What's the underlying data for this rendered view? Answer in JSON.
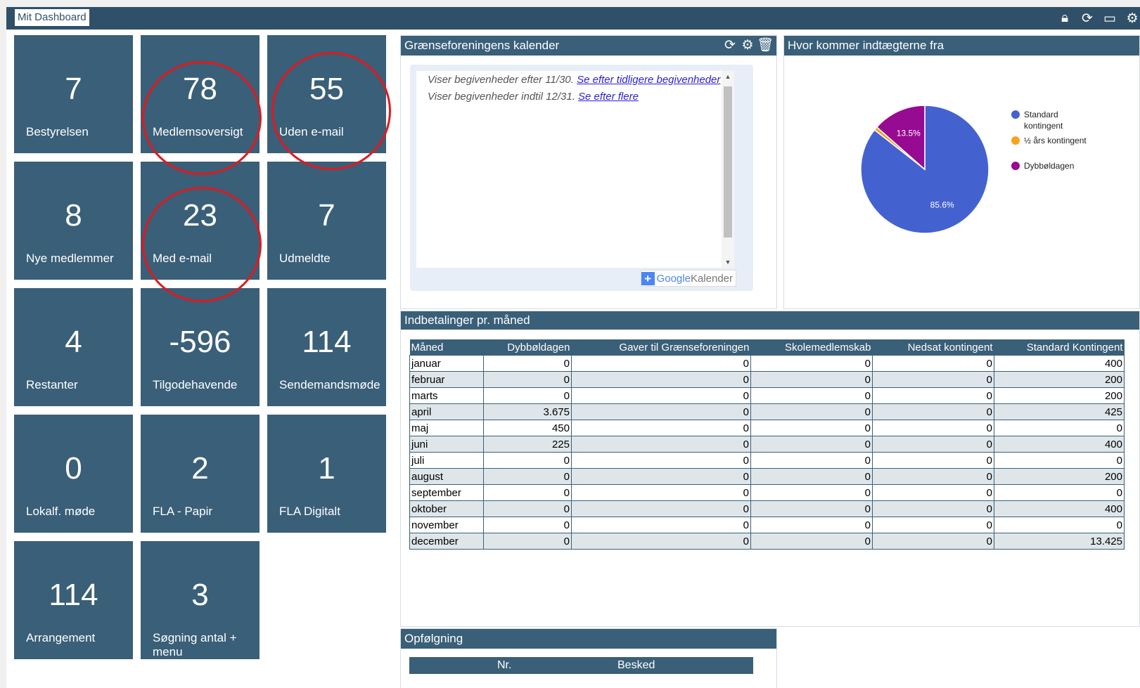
{
  "app_title": "Mit Dashboard",
  "top_icons": [
    "lock-icon",
    "refresh-icon",
    "monitor-settings-icon",
    "gear-icon"
  ],
  "tiles": [
    {
      "value": "7",
      "label": "Bestyrelsen"
    },
    {
      "value": "78",
      "label": "Medlemsoversigt"
    },
    {
      "value": "55",
      "label": "Uden e-mail"
    },
    {
      "value": "8",
      "label": "Nye medlemmer"
    },
    {
      "value": "23",
      "label": "Med e-mail"
    },
    {
      "value": "7",
      "label": "Udmeldte"
    },
    {
      "value": "4",
      "label": "Restanter"
    },
    {
      "value": "-596",
      "label": "Tilgodehavende"
    },
    {
      "value": "114",
      "label": "Sendemandsmøde"
    },
    {
      "value": "0",
      "label": "Lokalf. møde"
    },
    {
      "value": "2",
      "label": "FLA - Papir"
    },
    {
      "value": "1",
      "label": "FLA Digitalt"
    },
    {
      "value": "114",
      "label": "Arrangement"
    },
    {
      "value": "3",
      "label": "Søgning antal + menu"
    }
  ],
  "calendar": {
    "title": "Grænseforeningens kalender",
    "line1_text": "Viser begivenheder efter 11/30.",
    "line1_link": "Se efter tidligere begivenheder",
    "line2_text": "Viser begivenheder indtil 12/31.",
    "line2_link": "Se efter flere",
    "google_brand": "Google",
    "calendar_word": "Kalender"
  },
  "income": {
    "title": "Hvor kommer indtægterne fra",
    "legend": [
      {
        "label": "Standard kontingent",
        "color": "#4462cf"
      },
      {
        "label": "½ års kontingent",
        "color": "#f7a21c"
      },
      {
        "label": "Dybbøldagen",
        "color": "#970a92"
      }
    ],
    "slice_labels": [
      "85.6%",
      "13.5%"
    ]
  },
  "chart_data": {
    "type": "pie",
    "categories": [
      "Standard kontingent",
      "½ års kontingent",
      "Dybbøldagen"
    ],
    "values": [
      85.6,
      0.9,
      13.5
    ],
    "colors": [
      "#4462cf",
      "#f7a21c",
      "#970a92"
    ],
    "title": "Hvor kommer indtægterne fra",
    "legend": "right"
  },
  "payments": {
    "title": "Indbetalinger pr. måned",
    "columns": [
      "Måned",
      "Dybbøldagen",
      "Gaver til Grænseforeningen",
      "Skolemedlemskab",
      "Nedsat kontingent",
      "Standard Kontingent"
    ],
    "rows": [
      [
        "januar",
        "0",
        "0",
        "0",
        "0",
        "400"
      ],
      [
        "februar",
        "0",
        "0",
        "0",
        "0",
        "200"
      ],
      [
        "marts",
        "0",
        "0",
        "0",
        "0",
        "200"
      ],
      [
        "april",
        "3.675",
        "0",
        "0",
        "0",
        "425"
      ],
      [
        "maj",
        "450",
        "0",
        "0",
        "0",
        "0"
      ],
      [
        "juni",
        "225",
        "0",
        "0",
        "0",
        "400"
      ],
      [
        "juli",
        "0",
        "0",
        "0",
        "0",
        "0"
      ],
      [
        "august",
        "0",
        "0",
        "0",
        "0",
        "200"
      ],
      [
        "september",
        "0",
        "0",
        "0",
        "0",
        "0"
      ],
      [
        "oktober",
        "0",
        "0",
        "0",
        "0",
        "400"
      ],
      [
        "november",
        "0",
        "0",
        "0",
        "0",
        "0"
      ],
      [
        "december",
        "0",
        "0",
        "0",
        "0",
        "13.425"
      ]
    ]
  },
  "followup": {
    "title": "Opfølgning",
    "col_nr": "Nr.",
    "col_besked": "Besked"
  }
}
